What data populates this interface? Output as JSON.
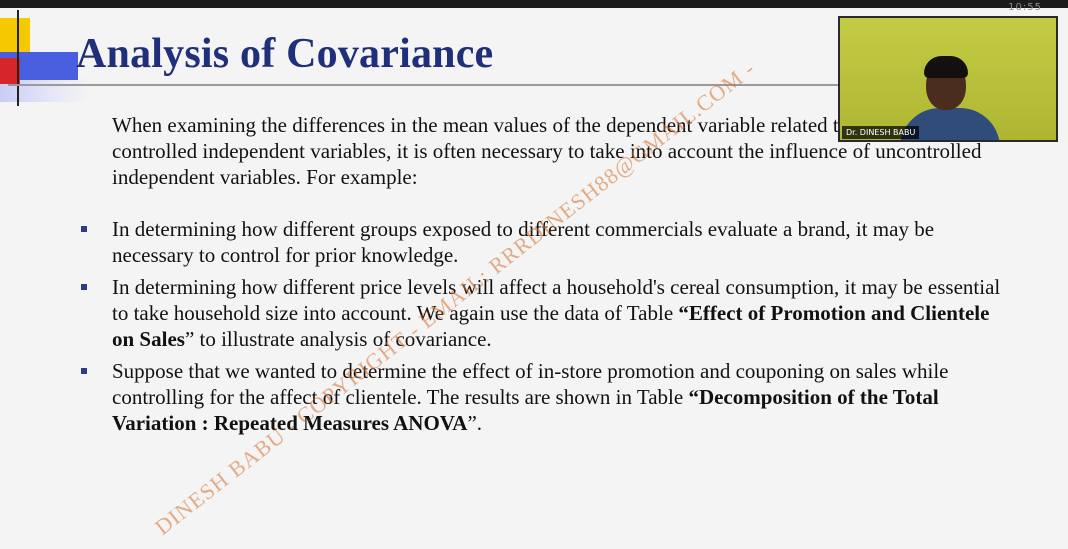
{
  "status": {
    "clock": "10:55"
  },
  "slide": {
    "title": "Analysis of Covariance",
    "intro": "When examining the differences in the mean values of the dependent variable related to the effect of the controlled independent variables, it is often necessary to take into account the influence of uncontrolled independent variables.  For example:",
    "bullets": [
      {
        "text": "In determining how different groups exposed to different commercials evaluate a brand, it may be necessary to control for prior knowledge."
      },
      {
        "pre": "In determining how different price levels will affect a household's cereal consumption, it may be essential to take household size into account. We again use the data of Table ",
        "bold": "“Effect of Promotion and Clientele on Sales",
        "post": "” to illustrate analysis of covariance."
      },
      {
        "pre": "Suppose that we wanted to determine the effect of in-store promotion and couponing on sales while controlling for the affect of clientele.  The results are shown in Table ",
        "bold": "“Decomposition of the Total Variation : Repeated Measures ANOVA",
        "post": "”."
      }
    ],
    "watermark": "DINESH BABU - COPYRIGHT - EMAIL: RRRDINESH88@GMAIL.COM -"
  },
  "webcam": {
    "name_label": "Dr. DINESH BABU"
  },
  "colors": {
    "title": "#1f2f7a",
    "bullet": "#2b3a8c",
    "watermark": "#d66e28",
    "webcam_bg": "#b8c238"
  }
}
